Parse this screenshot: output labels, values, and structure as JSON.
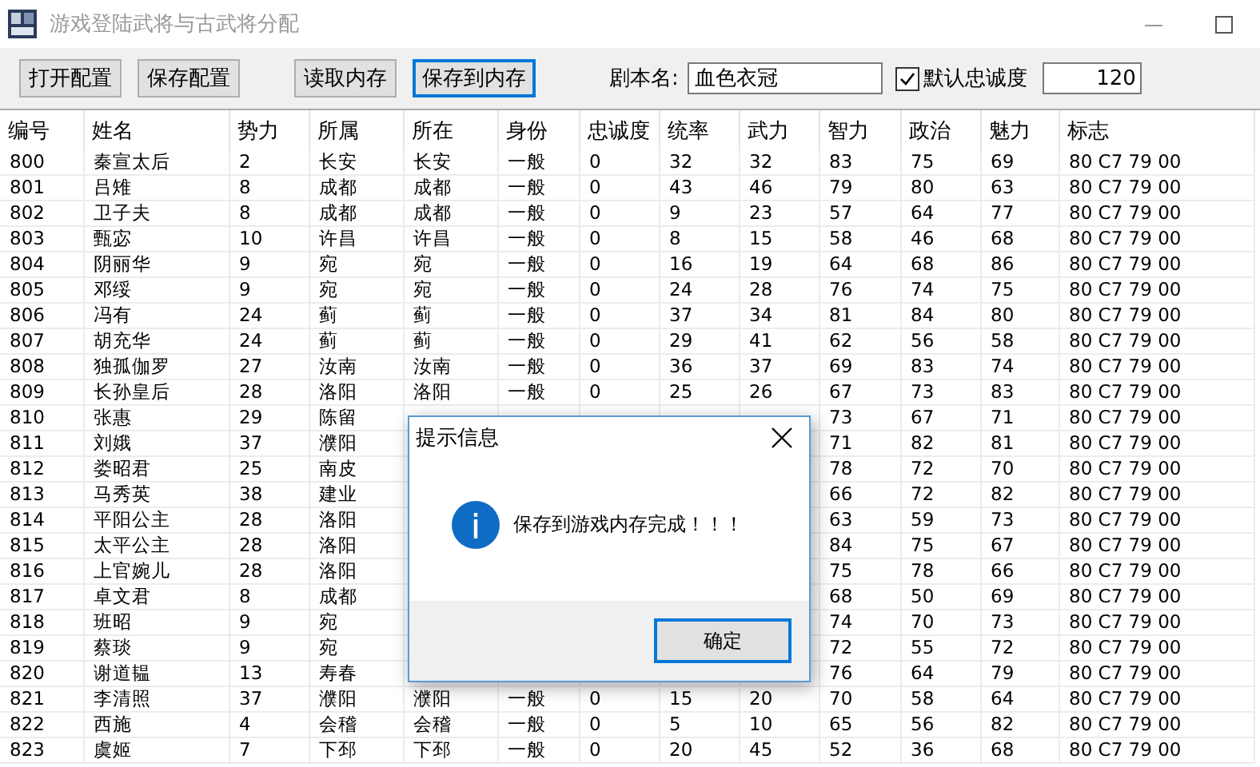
{
  "window": {
    "title": "游戏登陆武将与古武将分配"
  },
  "toolbar": {
    "buttons": [
      {
        "label": "打开配置",
        "focused": false
      },
      {
        "label": "保存配置",
        "focused": false
      },
      {
        "label": "读取内存",
        "focused": false
      },
      {
        "label": "保存到内存",
        "focused": true
      }
    ],
    "script_label": "剧本名:",
    "script_name": "血色衣冠",
    "loyalty_default": {
      "label": "默认忠诚度",
      "checked": true,
      "value": "120"
    }
  },
  "table": {
    "columns": [
      "编号",
      "姓名",
      "势力",
      "所属",
      "所在",
      "身份",
      "忠诚度",
      "统率",
      "武力",
      "智力",
      "政治",
      "魅力",
      "标志"
    ],
    "rows": [
      {
        "id": "800",
        "name": "秦宣太后",
        "faction": "2",
        "belongs": "长安",
        "location": "长安",
        "status": "一般",
        "loyalty": "0",
        "command": "32",
        "force": "32",
        "intellect": "83",
        "politics": "75",
        "charm": "69",
        "flag": "80 C7 79 00"
      },
      {
        "id": "801",
        "name": "吕雉",
        "faction": "8",
        "belongs": "成都",
        "location": "成都",
        "status": "一般",
        "loyalty": "0",
        "command": "43",
        "force": "46",
        "intellect": "79",
        "politics": "80",
        "charm": "63",
        "flag": "80 C7 79 00"
      },
      {
        "id": "802",
        "name": "卫子夫",
        "faction": "8",
        "belongs": "成都",
        "location": "成都",
        "status": "一般",
        "loyalty": "0",
        "command": "9",
        "force": "23",
        "intellect": "57",
        "politics": "64",
        "charm": "77",
        "flag": "80 C7 79 00"
      },
      {
        "id": "803",
        "name": "甄宓",
        "faction": "10",
        "belongs": "许昌",
        "location": "许昌",
        "status": "一般",
        "loyalty": "0",
        "command": "8",
        "force": "15",
        "intellect": "58",
        "politics": "46",
        "charm": "68",
        "flag": "80 C7 79 00"
      },
      {
        "id": "804",
        "name": "阴丽华",
        "faction": "9",
        "belongs": "宛",
        "location": "宛",
        "status": "一般",
        "loyalty": "0",
        "command": "16",
        "force": "19",
        "intellect": "64",
        "politics": "68",
        "charm": "86",
        "flag": "80 C7 79 00"
      },
      {
        "id": "805",
        "name": "邓绥",
        "faction": "9",
        "belongs": "宛",
        "location": "宛",
        "status": "一般",
        "loyalty": "0",
        "command": "24",
        "force": "28",
        "intellect": "76",
        "politics": "74",
        "charm": "75",
        "flag": "80 C7 79 00"
      },
      {
        "id": "806",
        "name": "冯有",
        "faction": "24",
        "belongs": "蓟",
        "location": "蓟",
        "status": "一般",
        "loyalty": "0",
        "command": "37",
        "force": "34",
        "intellect": "81",
        "politics": "84",
        "charm": "80",
        "flag": "80 C7 79 00"
      },
      {
        "id": "807",
        "name": "胡充华",
        "faction": "24",
        "belongs": "蓟",
        "location": "蓟",
        "status": "一般",
        "loyalty": "0",
        "command": "29",
        "force": "41",
        "intellect": "62",
        "politics": "56",
        "charm": "58",
        "flag": "80 C7 79 00"
      },
      {
        "id": "808",
        "name": "独孤伽罗",
        "faction": "27",
        "belongs": "汝南",
        "location": "汝南",
        "status": "一般",
        "loyalty": "0",
        "command": "36",
        "force": "37",
        "intellect": "69",
        "politics": "83",
        "charm": "74",
        "flag": "80 C7 79 00"
      },
      {
        "id": "809",
        "name": "长孙皇后",
        "faction": "28",
        "belongs": "洛阳",
        "location": "洛阳",
        "status": "一般",
        "loyalty": "0",
        "command": "25",
        "force": "26",
        "intellect": "67",
        "politics": "73",
        "charm": "83",
        "flag": "80 C7 79 00"
      },
      {
        "id": "810",
        "name": "张惠",
        "faction": "29",
        "belongs": "陈留",
        "intellect": "73",
        "politics": "67",
        "charm": "71",
        "flag": "80 C7 79 00"
      },
      {
        "id": "811",
        "name": "刘娥",
        "faction": "37",
        "belongs": "濮阳",
        "intellect": "71",
        "politics": "82",
        "charm": "81",
        "flag": "80 C7 79 00"
      },
      {
        "id": "812",
        "name": "娄昭君",
        "faction": "25",
        "belongs": "南皮",
        "intellect": "78",
        "politics": "72",
        "charm": "70",
        "flag": "80 C7 79 00"
      },
      {
        "id": "813",
        "name": "马秀英",
        "faction": "38",
        "belongs": "建业",
        "intellect": "66",
        "politics": "72",
        "charm": "82",
        "flag": "80 C7 79 00"
      },
      {
        "id": "814",
        "name": "平阳公主",
        "faction": "28",
        "belongs": "洛阳",
        "intellect": "63",
        "politics": "59",
        "charm": "73",
        "flag": "80 C7 79 00"
      },
      {
        "id": "815",
        "name": "太平公主",
        "faction": "28",
        "belongs": "洛阳",
        "intellect": "84",
        "politics": "75",
        "charm": "67",
        "flag": "80 C7 79 00"
      },
      {
        "id": "816",
        "name": "上官婉儿",
        "faction": "28",
        "belongs": "洛阳",
        "intellect": "75",
        "politics": "78",
        "charm": "66",
        "flag": "80 C7 79 00"
      },
      {
        "id": "817",
        "name": "卓文君",
        "faction": "8",
        "belongs": "成都",
        "intellect": "68",
        "politics": "50",
        "charm": "69",
        "flag": "80 C7 79 00"
      },
      {
        "id": "818",
        "name": "班昭",
        "faction": "9",
        "belongs": "宛",
        "intellect": "74",
        "politics": "70",
        "charm": "73",
        "flag": "80 C7 79 00"
      },
      {
        "id": "819",
        "name": "蔡琰",
        "faction": "9",
        "belongs": "宛",
        "intellect": "72",
        "politics": "55",
        "charm": "72",
        "flag": "80 C7 79 00"
      },
      {
        "id": "820",
        "name": "谢道韫",
        "faction": "13",
        "belongs": "寿春",
        "intellect": "76",
        "politics": "64",
        "charm": "79",
        "flag": "80 C7 79 00"
      },
      {
        "id": "821",
        "name": "李清照",
        "faction": "37",
        "belongs": "濮阳",
        "location": "濮阳",
        "status": "一般",
        "loyalty": "0",
        "command": "15",
        "force": "20",
        "intellect": "70",
        "politics": "58",
        "charm": "64",
        "flag": "80 C7 79 00"
      },
      {
        "id": "822",
        "name": "西施",
        "faction": "4",
        "belongs": "会稽",
        "location": "会稽",
        "status": "一般",
        "loyalty": "0",
        "command": "5",
        "force": "10",
        "intellect": "65",
        "politics": "56",
        "charm": "82",
        "flag": "80 C7 79 00"
      },
      {
        "id": "823",
        "name": "虞姬",
        "faction": "7",
        "belongs": "下邳",
        "location": "下邳",
        "status": "一般",
        "loyalty": "0",
        "command": "20",
        "force": "45",
        "intellect": "52",
        "politics": "36",
        "charm": "68",
        "flag": "80 C7 79 00"
      }
    ]
  },
  "dialog": {
    "title": "提示信息",
    "message": "保存到游戏内存完成！！！",
    "button": {
      "label": "确定",
      "focused": true
    }
  }
}
